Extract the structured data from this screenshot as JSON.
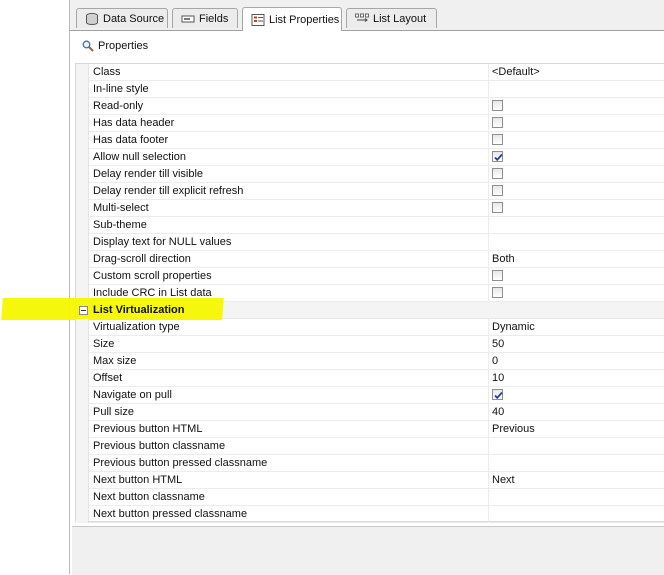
{
  "tabs": [
    {
      "label": "Data Source",
      "icon": "database-icon",
      "active": false
    },
    {
      "label": "Fields",
      "icon": "fields-icon",
      "active": false
    },
    {
      "label": "List Properties",
      "icon": "list-properties-icon",
      "active": true
    },
    {
      "label": "List Layout",
      "icon": "list-layout-icon",
      "active": false
    }
  ],
  "properties_header": {
    "label": "Properties",
    "icon": "magnifier-icon"
  },
  "rows": [
    {
      "name": "Class",
      "value": "<Default>"
    },
    {
      "name": "In-line style",
      "value": ""
    },
    {
      "name": "Read-only",
      "checkbox": false
    },
    {
      "name": "Has data header",
      "checkbox": false
    },
    {
      "name": "Has data footer",
      "checkbox": false
    },
    {
      "name": "Allow null selection",
      "checkbox": true
    },
    {
      "name": "Delay render till visible",
      "checkbox": false
    },
    {
      "name": "Delay render till explicit refresh",
      "checkbox": false
    },
    {
      "name": "Multi-select",
      "checkbox": false
    },
    {
      "name": "Sub-theme",
      "value": ""
    },
    {
      "name": "Display text for NULL values",
      "value": ""
    },
    {
      "name": "Drag-scroll direction",
      "value": "Both"
    },
    {
      "name": "Custom scroll properties",
      "checkbox": false
    },
    {
      "name": "Include CRC in List data",
      "checkbox": false
    },
    {
      "category": "List Virtualization"
    },
    {
      "name": "Virtualization type",
      "value": "Dynamic"
    },
    {
      "name": "Size",
      "value": "50"
    },
    {
      "name": "Max size",
      "value": "0"
    },
    {
      "name": "Offset",
      "value": "10"
    },
    {
      "name": "Navigate on pull",
      "checkbox": true
    },
    {
      "name": "Pull size",
      "value": "40"
    },
    {
      "name": "Previous button HTML",
      "value": "Previous"
    },
    {
      "name": "Previous button classname",
      "value": ""
    },
    {
      "name": "Previous button pressed classname",
      "value": ""
    },
    {
      "name": "Next button HTML",
      "value": "Next"
    },
    {
      "name": "Next button classname",
      "value": ""
    },
    {
      "name": "Next button pressed classname",
      "value": ""
    }
  ],
  "colors": {
    "highlight": "#f7f700",
    "check": "#1f3fa8"
  }
}
